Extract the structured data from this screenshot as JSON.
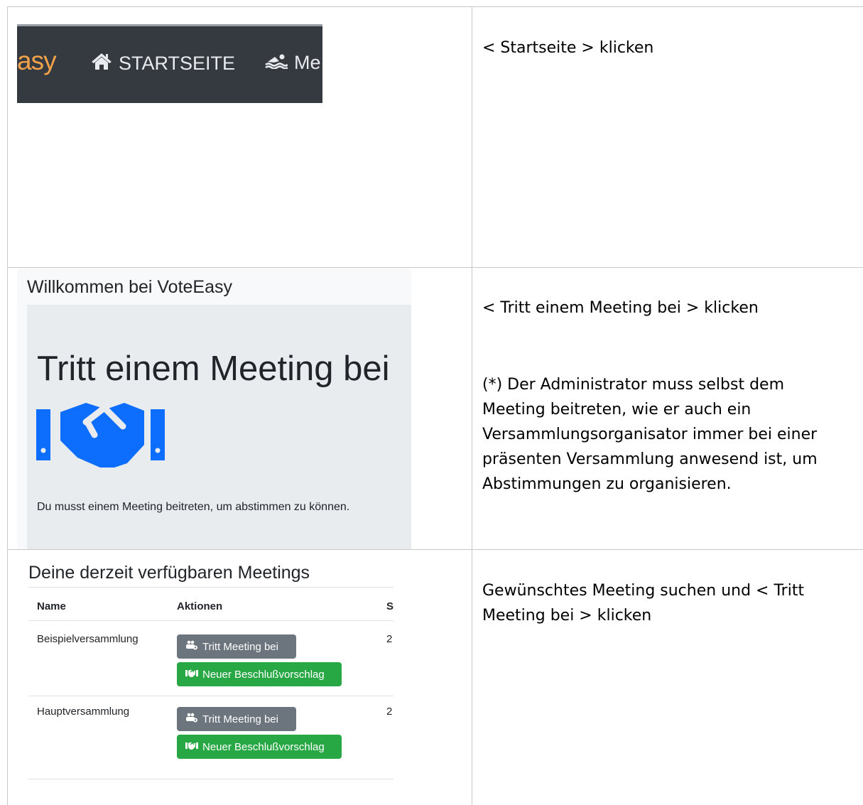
{
  "row1": {
    "nav": {
      "brand_fragment": "asy",
      "home_label": "STARTSEITE",
      "meetings_fragment": "Me"
    },
    "instruction": "< Startseite > klicken"
  },
  "row2": {
    "welcome_title": "Willkommen bei VoteEasy",
    "jumbotron_heading": "Tritt einem Meeting bei",
    "jumbotron_text": "Du musst einem Meeting beitreten, um abstimmen zu können.",
    "instruction": "< Tritt einem Meeting bei > klicken",
    "note": "(*) Der Administrator muss selbst dem Meeting beitreten, wie er auch ein Versammlungsorganisator immer bei einer präsenten Versammlung anwesend ist, um Abstimmungen zu organisieren."
  },
  "row3": {
    "title": "Deine derzeit verfügbaren Meetings",
    "headers": {
      "name": "Name",
      "actions": "Aktionen",
      "third_fragment": "S"
    },
    "rows": [
      {
        "name": "Beispielversammlung",
        "join_label": "Tritt Meeting bei",
        "propose_label": "Neuer Beschlußvorschlag",
        "third_fragment": "2"
      },
      {
        "name": "Hauptversammlung",
        "join_label": "Tritt Meeting bei",
        "propose_label": "Neuer Beschlußvorschlag",
        "third_fragment": "2"
      }
    ],
    "instruction": "Gewünschtes Meeting suchen und < Tritt Meeting bei > klicken"
  },
  "colors": {
    "navbar": "#343a40",
    "brand": "#f0a24b",
    "jumbotron": "#e9ecef",
    "handshake": "#0d6efd",
    "button_gray": "#6c757d",
    "button_green": "#28a745"
  },
  "icons": {
    "home": "home-icon",
    "meetings": "swimmer-icon",
    "handshake": "handshake-icon",
    "join": "users-cog-icon",
    "propose": "handshake-small-icon"
  }
}
